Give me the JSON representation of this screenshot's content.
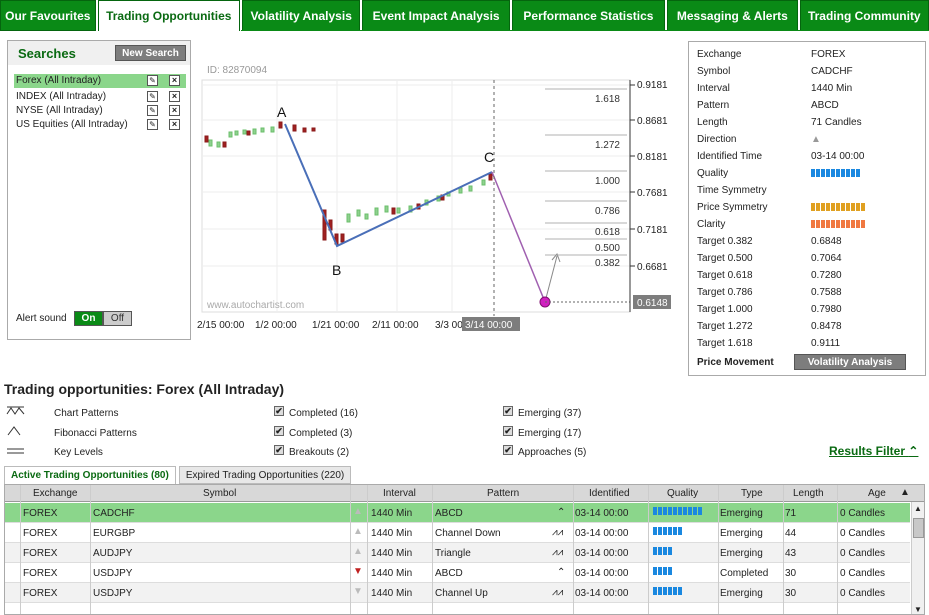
{
  "tabs": [
    "Our Favourites",
    "Trading Opportunities",
    "Volatility Analysis",
    "Event Impact Analysis",
    "Performance Statistics",
    "Messaging & Alerts",
    "Trading Community"
  ],
  "active_tab": "Trading Opportunities",
  "searches": {
    "title": "Searches",
    "new_button": "New Search",
    "items": [
      "Forex (All Intraday)",
      "INDEX (All Intraday)",
      "NYSE (All Intraday)",
      "US Equities (All Intraday)"
    ],
    "alert_label": "Alert sound",
    "on_label": "On",
    "off_label": "Off"
  },
  "chart": {
    "id_label": "ID: 82870094",
    "watermark": "www.autochartist.com",
    "price_labels": [
      "0.9181",
      "0.8681",
      "0.8181",
      "0.7681",
      "0.7181",
      "0.6681",
      "0.6148"
    ],
    "date_labels": [
      "2/15 00:00",
      "1/2 00:00",
      "1/21 00:00",
      "2/11 00:00",
      "3/3 00:00",
      "3/14 00:00"
    ],
    "fib_levels": [
      "1.618",
      "1.272",
      "1.000",
      "0.786",
      "0.618",
      "0.500",
      "0.382"
    ],
    "point_labels": [
      "A",
      "B",
      "C"
    ]
  },
  "info": {
    "rows": [
      {
        "k": "Exchange",
        "v": "FOREX"
      },
      {
        "k": "Symbol",
        "v": "CADCHF"
      },
      {
        "k": "Interval",
        "v": "1440 Min"
      },
      {
        "k": "Pattern",
        "v": "ABCD"
      },
      {
        "k": "Length",
        "v": "71 Candles"
      },
      {
        "k": "Direction",
        "v": "▲"
      },
      {
        "k": "Identified Time",
        "v": "03-14 00:00"
      },
      {
        "k": "Quality",
        "v": ""
      },
      {
        "k": "Time Symmetry",
        "v": ""
      },
      {
        "k": "Price Symmetry",
        "v": ""
      },
      {
        "k": "Clarity",
        "v": ""
      },
      {
        "k": "Target 0.382",
        "v": "0.6848"
      },
      {
        "k": "Target 0.500",
        "v": "0.7064"
      },
      {
        "k": "Target 0.618",
        "v": "0.7280"
      },
      {
        "k": "Target 0.786",
        "v": "0.7588"
      },
      {
        "k": "Target 1.000",
        "v": "0.7980"
      },
      {
        "k": "Target 1.272",
        "v": "0.8478"
      },
      {
        "k": "Target 1.618",
        "v": "0.9111"
      }
    ],
    "price_movement": "Price Movement",
    "vol_button": "Volatility Analysis",
    "quality_level": 0.93,
    "price_symmetry_level": 1.0,
    "clarity_level": 1.0,
    "colors": {
      "quality": "#1a88e0",
      "price_symmetry": "#e0a020",
      "clarity": "#f07840"
    }
  },
  "section_title": "Trading opportunities: Forex (All Intraday)",
  "filters": {
    "types": [
      "Chart Patterns",
      "Fibonacci Patterns",
      "Key Levels"
    ],
    "col1": [
      "Completed (16)",
      "Completed (3)",
      "Breakouts (2)"
    ],
    "col2": [
      "Emerging (37)",
      "Emerging (17)",
      "Approaches (5)"
    ],
    "results_filter": "Results Filter"
  },
  "list_tabs": [
    "Active Trading Opportunities (80)",
    "Expired Trading Opportunities (220)"
  ],
  "table": {
    "headers": [
      "Exchange",
      "Symbol",
      "Interval",
      "Pattern",
      "Identified",
      "Quality",
      "Type",
      "Length",
      "Age"
    ],
    "rows": [
      {
        "exchange": "FOREX",
        "symbol": "CADCHF",
        "interval": "1440 Min",
        "pattern": "ABCD",
        "identified": "03-14 00:00",
        "quality": 10,
        "type": "Emerging",
        "length": "71",
        "age": "0 Candles"
      },
      {
        "exchange": "FOREX",
        "symbol": "EURGBP",
        "interval": "1440 Min",
        "pattern": "Channel Down",
        "identified": "03-14 00:00",
        "quality": 6,
        "type": "Emerging",
        "length": "44",
        "age": "0 Candles"
      },
      {
        "exchange": "FOREX",
        "symbol": "AUDJPY",
        "interval": "1440 Min",
        "pattern": "Triangle",
        "identified": "03-14 00:00",
        "quality": 4,
        "type": "Emerging",
        "length": "43",
        "age": "0 Candles"
      },
      {
        "exchange": "FOREX",
        "symbol": "USDJPY",
        "interval": "1440 Min",
        "pattern": "ABCD",
        "identified": "03-14 00:00",
        "quality": 4,
        "type": "Completed",
        "length": "30",
        "age": "0 Candles"
      },
      {
        "exchange": "FOREX",
        "symbol": "USDJPY",
        "interval": "1440 Min",
        "pattern": "Channel Up",
        "identified": "03-14 00:00",
        "quality": 6,
        "type": "Emerging",
        "length": "30",
        "age": "0 Candles"
      }
    ]
  }
}
